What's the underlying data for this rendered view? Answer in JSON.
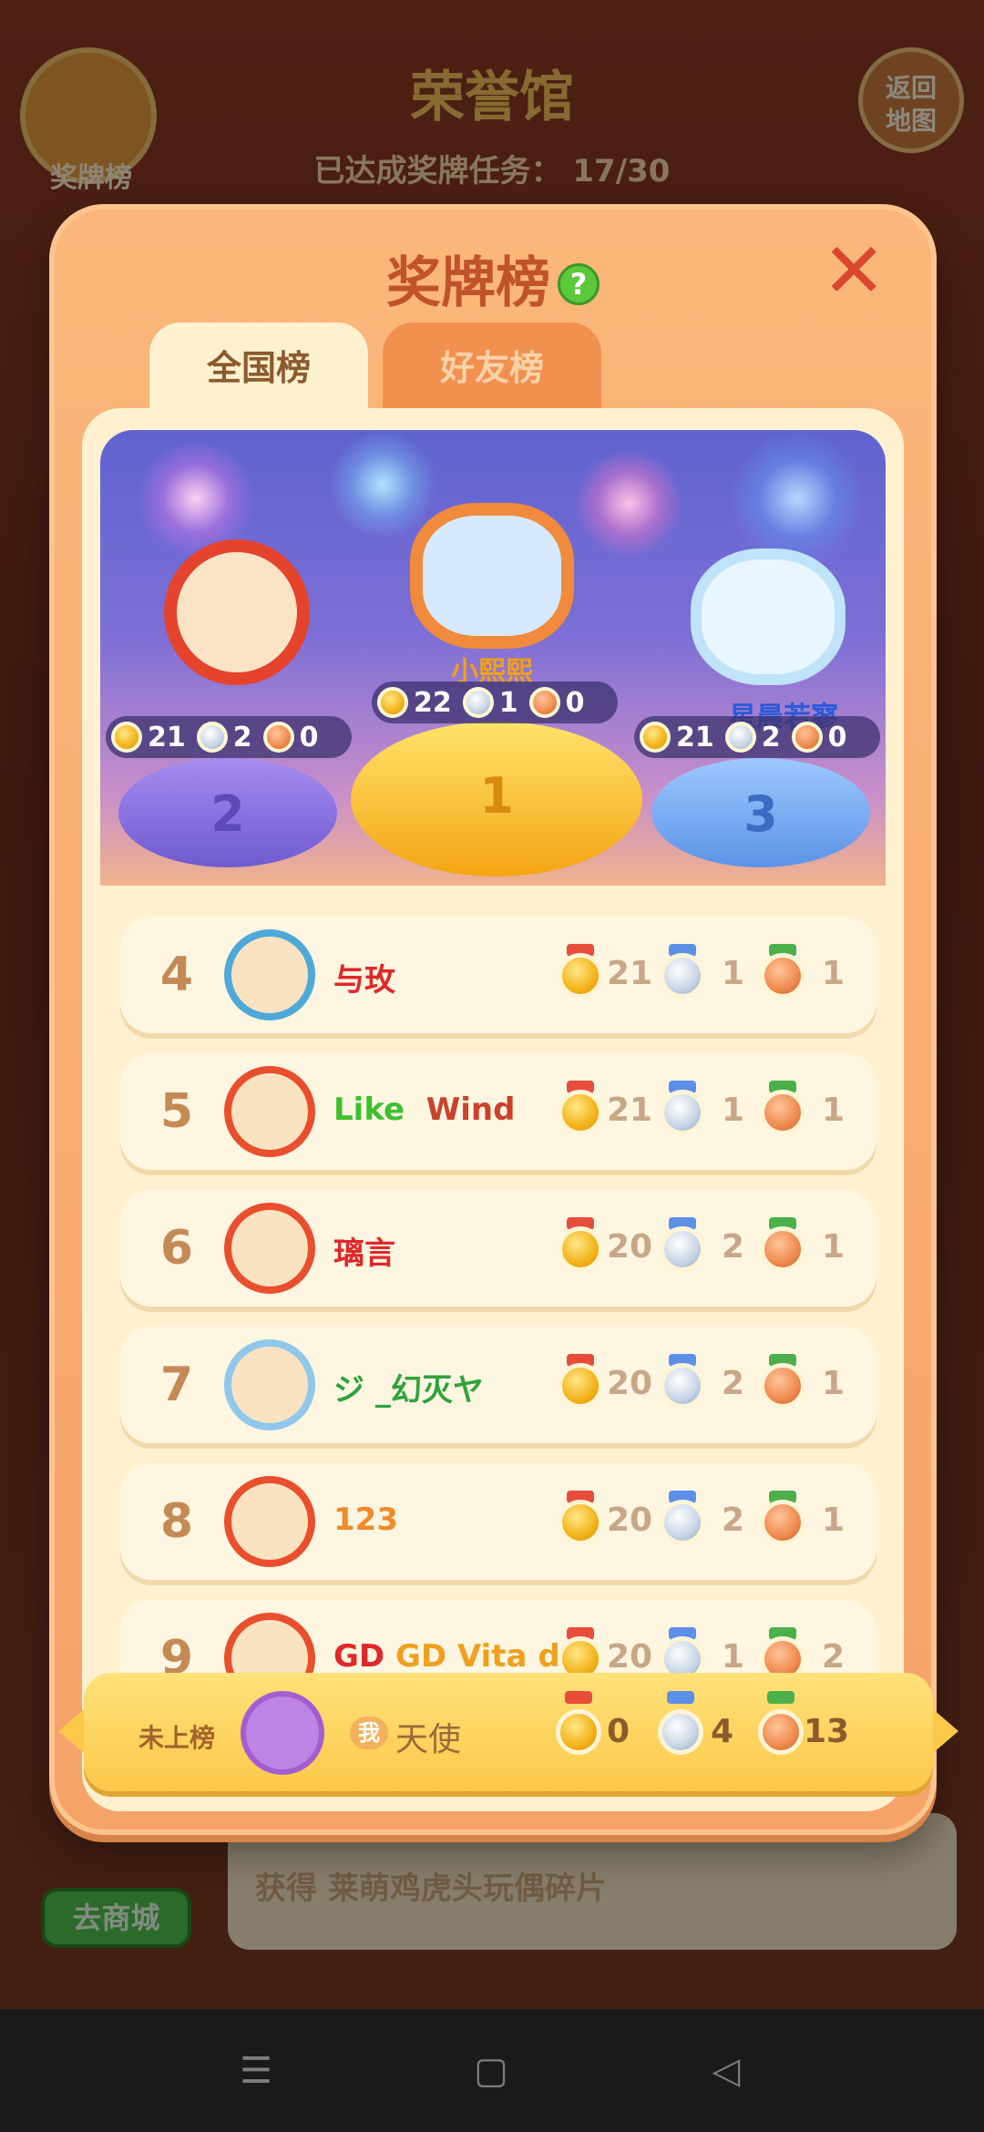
{
  "background": {
    "medal_button_label": "奖牌榜",
    "title": "荣誉馆",
    "progress_label": "已达成奖牌任务：",
    "progress_value": "17/30",
    "back_button_line1": "返回",
    "back_button_line2": "地图",
    "reward_text": "获得 莱萌鸡虎头玩偶碎片",
    "shop_button": "去商城"
  },
  "modal": {
    "title": "奖牌榜",
    "tabs": [
      {
        "label": "全国榜",
        "active": true
      },
      {
        "label": "好友榜",
        "active": false
      }
    ]
  },
  "podium": [
    {
      "place": "1",
      "name": "小熙熙",
      "name_color": "#f2a018",
      "gold": "22",
      "silver": "1",
      "bronze": "0"
    },
    {
      "place": "2",
      "name": "",
      "name_color": "#ffffff",
      "gold": "21",
      "silver": "2",
      "bronze": "0"
    },
    {
      "place": "3",
      "name": "星晨若寥",
      "name_color": "#2a5ad8",
      "gold": "21",
      "silver": "2",
      "bronze": "0"
    }
  ],
  "rankings": [
    {
      "rank": "4",
      "name": "与玫",
      "name_color": "#e0282a",
      "gold": "21",
      "silver": "1",
      "bronze": "1",
      "frame_color": "#4ea9d8"
    },
    {
      "rank": "5",
      "name_parts": [
        "Like",
        "Wind"
      ],
      "name_colors": [
        "#3fbf2f",
        "#c8432a"
      ],
      "gold": "21",
      "silver": "1",
      "bronze": "1",
      "frame_color": "#e94f2c"
    },
    {
      "rank": "6",
      "name": "璃言",
      "name_color": "#e0282a",
      "gold": "20",
      "silver": "2",
      "bronze": "1",
      "frame_color": "#e94f2c"
    },
    {
      "rank": "7",
      "name": "ジ _幻灭ヤ",
      "name_color": "#2fa33a",
      "gold": "20",
      "silver": "2",
      "bronze": "1",
      "frame_color": "#8fc8ea"
    },
    {
      "rank": "8",
      "name": "123",
      "name_color": "#f08a2a",
      "gold": "20",
      "silver": "2",
      "bronze": "1",
      "frame_color": "#e94f2c"
    },
    {
      "rank": "9",
      "name": "GD Vita d...",
      "name_color": "#e0282a",
      "gold": "20",
      "silver": "1",
      "bronze": "2",
      "frame_color": "#e94f2c"
    }
  ],
  "my_rank": {
    "status": "未上榜",
    "me_badge": "我",
    "name": "天使",
    "gold": "0",
    "silver": "4",
    "bronze": "13"
  },
  "colors": {
    "gold_medal": "#f3b218",
    "silver_medal": "#c7d5e6",
    "bronze_medal": "#ef8a4e",
    "help_icon": "#5cc83b",
    "close_icon": "#d9482e"
  }
}
